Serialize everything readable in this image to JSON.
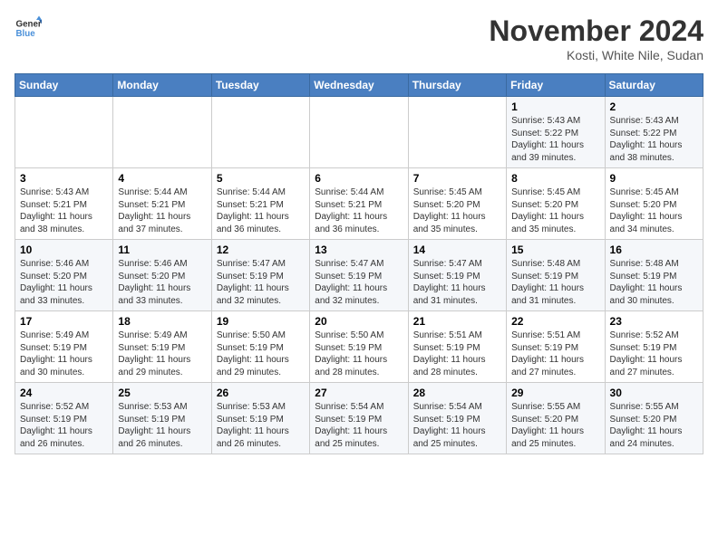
{
  "header": {
    "logo_general": "General",
    "logo_blue": "Blue",
    "month_title": "November 2024",
    "location": "Kosti, White Nile, Sudan"
  },
  "weekdays": [
    "Sunday",
    "Monday",
    "Tuesday",
    "Wednesday",
    "Thursday",
    "Friday",
    "Saturday"
  ],
  "weeks": [
    [
      {
        "day": "",
        "info": ""
      },
      {
        "day": "",
        "info": ""
      },
      {
        "day": "",
        "info": ""
      },
      {
        "day": "",
        "info": ""
      },
      {
        "day": "",
        "info": ""
      },
      {
        "day": "1",
        "info": "Sunrise: 5:43 AM\nSunset: 5:22 PM\nDaylight: 11 hours and 39 minutes."
      },
      {
        "day": "2",
        "info": "Sunrise: 5:43 AM\nSunset: 5:22 PM\nDaylight: 11 hours and 38 minutes."
      }
    ],
    [
      {
        "day": "3",
        "info": "Sunrise: 5:43 AM\nSunset: 5:21 PM\nDaylight: 11 hours and 38 minutes."
      },
      {
        "day": "4",
        "info": "Sunrise: 5:44 AM\nSunset: 5:21 PM\nDaylight: 11 hours and 37 minutes."
      },
      {
        "day": "5",
        "info": "Sunrise: 5:44 AM\nSunset: 5:21 PM\nDaylight: 11 hours and 36 minutes."
      },
      {
        "day": "6",
        "info": "Sunrise: 5:44 AM\nSunset: 5:21 PM\nDaylight: 11 hours and 36 minutes."
      },
      {
        "day": "7",
        "info": "Sunrise: 5:45 AM\nSunset: 5:20 PM\nDaylight: 11 hours and 35 minutes."
      },
      {
        "day": "8",
        "info": "Sunrise: 5:45 AM\nSunset: 5:20 PM\nDaylight: 11 hours and 35 minutes."
      },
      {
        "day": "9",
        "info": "Sunrise: 5:45 AM\nSunset: 5:20 PM\nDaylight: 11 hours and 34 minutes."
      }
    ],
    [
      {
        "day": "10",
        "info": "Sunrise: 5:46 AM\nSunset: 5:20 PM\nDaylight: 11 hours and 33 minutes."
      },
      {
        "day": "11",
        "info": "Sunrise: 5:46 AM\nSunset: 5:20 PM\nDaylight: 11 hours and 33 minutes."
      },
      {
        "day": "12",
        "info": "Sunrise: 5:47 AM\nSunset: 5:19 PM\nDaylight: 11 hours and 32 minutes."
      },
      {
        "day": "13",
        "info": "Sunrise: 5:47 AM\nSunset: 5:19 PM\nDaylight: 11 hours and 32 minutes."
      },
      {
        "day": "14",
        "info": "Sunrise: 5:47 AM\nSunset: 5:19 PM\nDaylight: 11 hours and 31 minutes."
      },
      {
        "day": "15",
        "info": "Sunrise: 5:48 AM\nSunset: 5:19 PM\nDaylight: 11 hours and 31 minutes."
      },
      {
        "day": "16",
        "info": "Sunrise: 5:48 AM\nSunset: 5:19 PM\nDaylight: 11 hours and 30 minutes."
      }
    ],
    [
      {
        "day": "17",
        "info": "Sunrise: 5:49 AM\nSunset: 5:19 PM\nDaylight: 11 hours and 30 minutes."
      },
      {
        "day": "18",
        "info": "Sunrise: 5:49 AM\nSunset: 5:19 PM\nDaylight: 11 hours and 29 minutes."
      },
      {
        "day": "19",
        "info": "Sunrise: 5:50 AM\nSunset: 5:19 PM\nDaylight: 11 hours and 29 minutes."
      },
      {
        "day": "20",
        "info": "Sunrise: 5:50 AM\nSunset: 5:19 PM\nDaylight: 11 hours and 28 minutes."
      },
      {
        "day": "21",
        "info": "Sunrise: 5:51 AM\nSunset: 5:19 PM\nDaylight: 11 hours and 28 minutes."
      },
      {
        "day": "22",
        "info": "Sunrise: 5:51 AM\nSunset: 5:19 PM\nDaylight: 11 hours and 27 minutes."
      },
      {
        "day": "23",
        "info": "Sunrise: 5:52 AM\nSunset: 5:19 PM\nDaylight: 11 hours and 27 minutes."
      }
    ],
    [
      {
        "day": "24",
        "info": "Sunrise: 5:52 AM\nSunset: 5:19 PM\nDaylight: 11 hours and 26 minutes."
      },
      {
        "day": "25",
        "info": "Sunrise: 5:53 AM\nSunset: 5:19 PM\nDaylight: 11 hours and 26 minutes."
      },
      {
        "day": "26",
        "info": "Sunrise: 5:53 AM\nSunset: 5:19 PM\nDaylight: 11 hours and 26 minutes."
      },
      {
        "day": "27",
        "info": "Sunrise: 5:54 AM\nSunset: 5:19 PM\nDaylight: 11 hours and 25 minutes."
      },
      {
        "day": "28",
        "info": "Sunrise: 5:54 AM\nSunset: 5:19 PM\nDaylight: 11 hours and 25 minutes."
      },
      {
        "day": "29",
        "info": "Sunrise: 5:55 AM\nSunset: 5:20 PM\nDaylight: 11 hours and 25 minutes."
      },
      {
        "day": "30",
        "info": "Sunrise: 5:55 AM\nSunset: 5:20 PM\nDaylight: 11 hours and 24 minutes."
      }
    ]
  ]
}
